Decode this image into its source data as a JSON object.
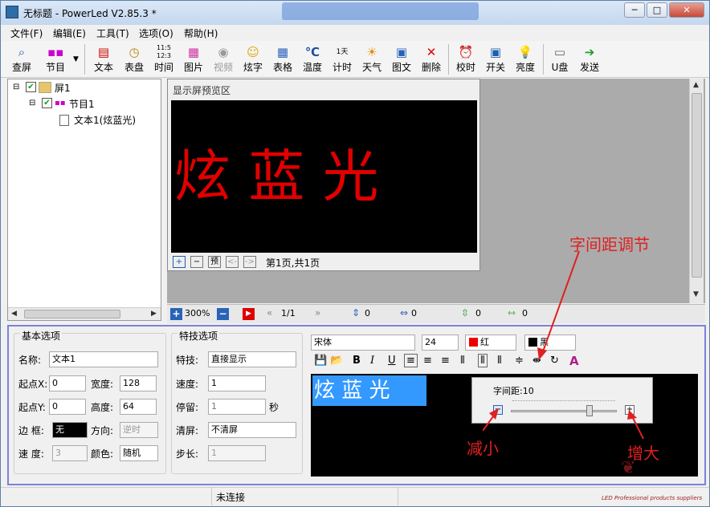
{
  "window": {
    "title": "无标题 - PowerLed V2.85.3 *",
    "min": "─",
    "max": "□",
    "close": "✕"
  },
  "menu": [
    "文件(F)",
    "编辑(E)",
    "工具(T)",
    "选项(O)",
    "帮助(H)"
  ],
  "toolbar": [
    {
      "label": "查屏",
      "icon": "search-icon"
    },
    {
      "label": "节目",
      "icon": "program-icon"
    },
    {
      "label": "文本",
      "icon": "text-icon"
    },
    {
      "label": "表盘",
      "icon": "clock-icon"
    },
    {
      "label": "时间",
      "icon": "time-icon"
    },
    {
      "label": "图片",
      "icon": "picture-icon"
    },
    {
      "label": "视频",
      "icon": "video-icon"
    },
    {
      "label": "炫字",
      "icon": "smiley-icon"
    },
    {
      "label": "表格",
      "icon": "table-icon"
    },
    {
      "label": "温度",
      "icon": "temperature-icon"
    },
    {
      "label": "计时",
      "icon": "timer-icon"
    },
    {
      "label": "天气",
      "icon": "weather-icon"
    },
    {
      "label": "图文",
      "icon": "image-text-icon"
    },
    {
      "label": "删除",
      "icon": "delete-icon"
    },
    {
      "label": "校时",
      "icon": "sync-time-icon"
    },
    {
      "label": "开关",
      "icon": "power-icon"
    },
    {
      "label": "亮度",
      "icon": "brightness-icon"
    },
    {
      "label": "U盘",
      "icon": "usb-icon"
    },
    {
      "label": "发送",
      "icon": "send-icon"
    }
  ],
  "tree": {
    "screen": "屏1",
    "program": "节目1",
    "text": "文本1(炫蓝光)"
  },
  "preview": {
    "title": "显示屏预览区",
    "content": "炫 蓝 光",
    "page_info": "第1页,共1页",
    "btn_add": "+",
    "btn_remove": "−",
    "btn_preview": "预",
    "btn_prev": "<-",
    "btn_next": "->"
  },
  "statusbar": {
    "zoom": "300%",
    "page": "1/1",
    "v1": "0",
    "v2": "0",
    "v3": "0",
    "v4": "0"
  },
  "basic": {
    "title": "基本选项",
    "name_label": "名称:",
    "name": "文本1",
    "x_label": "起点X:",
    "x": "0",
    "w_label": "宽度:",
    "w": "128",
    "y_label": "起点Y:",
    "y": "0",
    "h_label": "高度:",
    "h": "64",
    "border_label": "边 框:",
    "border": "无",
    "dir_label": "方向:",
    "dir": "逆时",
    "speed_label": "速 度:",
    "speed": "3",
    "color_label": "颜色:",
    "color": "随机"
  },
  "effect": {
    "title": "特技选项",
    "fx_label": "特技:",
    "fx": "直接显示",
    "speed_label": "速度:",
    "speed": "1",
    "stay_label": "停留:",
    "stay": "1",
    "stay_unit": "秒",
    "clear_label": "清屏:",
    "clear": "不清屏",
    "step_label": "步长:",
    "step": "1"
  },
  "font": {
    "name": "宋体",
    "size": "24",
    "color": "红",
    "bg": "黑"
  },
  "editor": {
    "text": "炫 蓝 光",
    "spacing_label": "字间距:10"
  },
  "annotations": {
    "spacing": "字间距调节",
    "decrease": "减小",
    "increase": "增大"
  },
  "status": {
    "connection": "未连接"
  },
  "watermark": "LED Professional products suppliers"
}
